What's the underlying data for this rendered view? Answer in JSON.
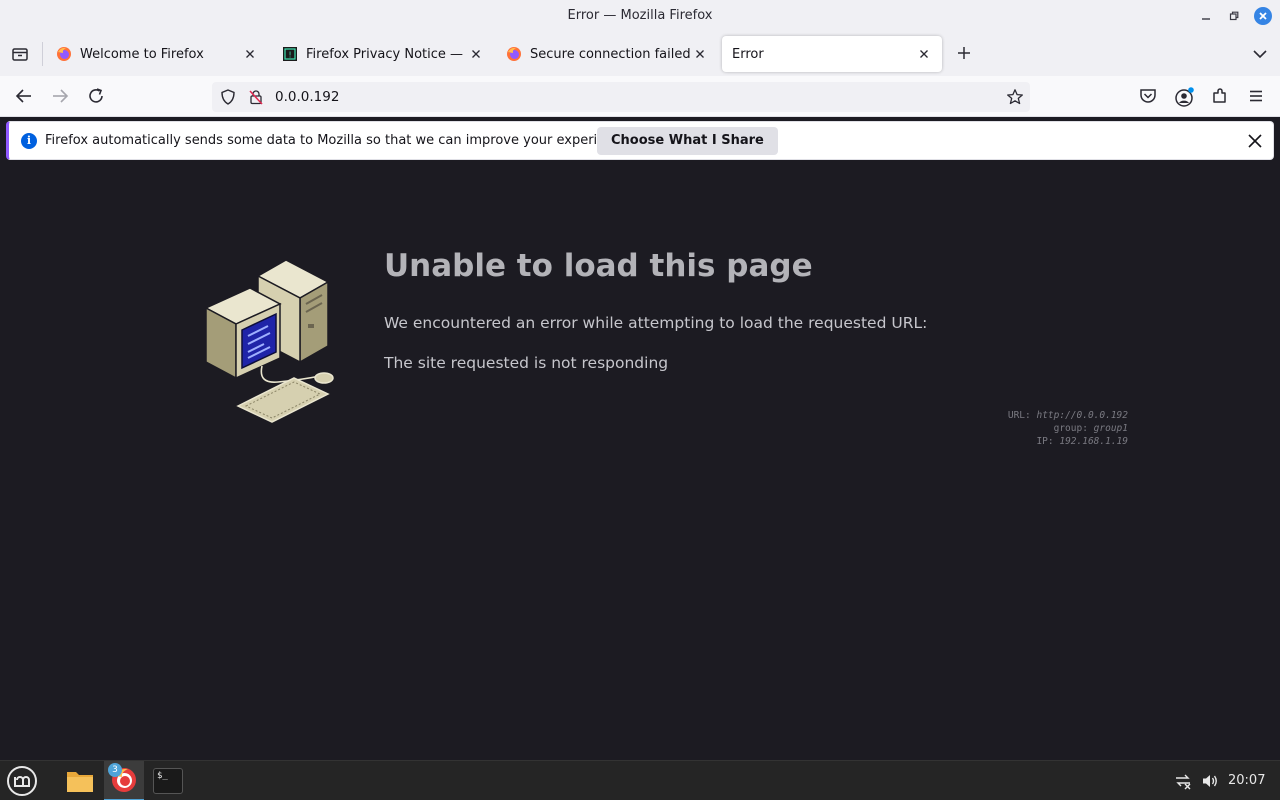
{
  "window": {
    "title": "Error — Mozilla Firefox"
  },
  "tabs": [
    {
      "label": "Welcome to Firefox",
      "icon": "firefox-icon",
      "active": false
    },
    {
      "label": "Firefox Privacy Notice — Mozilla",
      "icon": "privacy-notice-icon",
      "active": false
    },
    {
      "label": "Secure connection failed and Firefox",
      "icon": "firefox-icon",
      "active": false
    },
    {
      "label": "Error",
      "icon": "",
      "active": true
    }
  ],
  "urlbar": {
    "url": "0.0.0.192"
  },
  "notification": {
    "message": "Firefox automatically sends some data to Mozilla so that we can improve your experience.",
    "button": "Choose What I Share"
  },
  "error": {
    "heading": "Unable to load this page",
    "description": "We encountered an error while attempting to load the requested URL:",
    "detail": "The site requested is not responding",
    "meta": [
      {
        "key": "URL:",
        "value": "http://0.0.0.192"
      },
      {
        "key": "group:",
        "value": "group1"
      },
      {
        "key": "IP:",
        "value": "192.168.1.19"
      }
    ]
  },
  "taskbar": {
    "badge": "3",
    "time": "20:07",
    "terminal_glyph": "$_"
  },
  "colors": {
    "accent": "#9059ff",
    "info": "#0060df",
    "content_bg": "#1c1b22",
    "taskbar_active": "#4fa4d8"
  }
}
